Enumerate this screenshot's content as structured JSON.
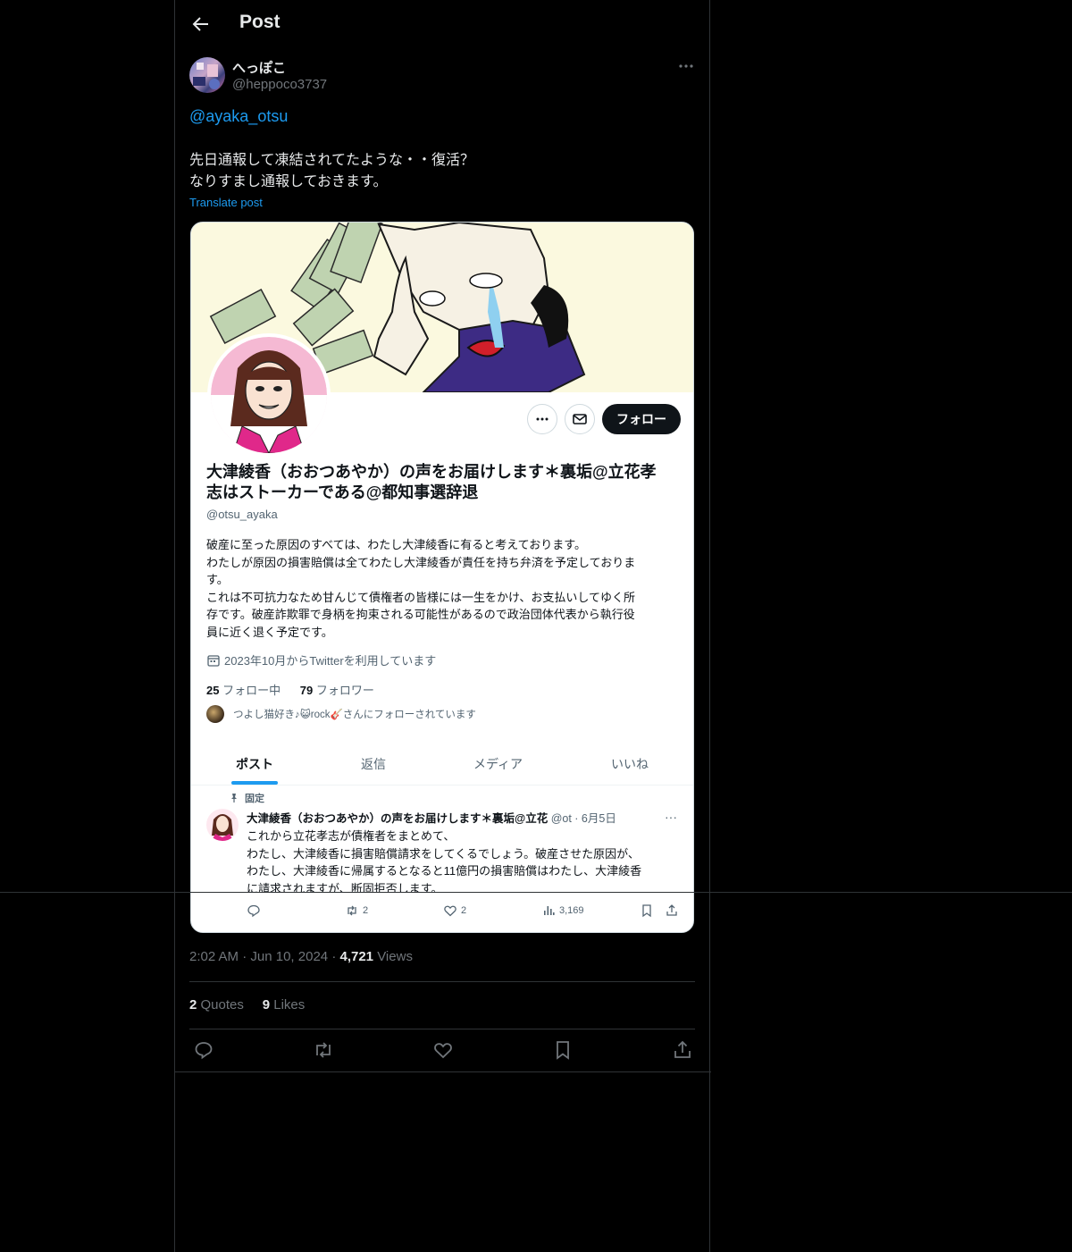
{
  "header": {
    "title": "Post"
  },
  "post": {
    "author_name": "へっぽこ",
    "author_handle": "@heppoco3737",
    "mention": "@ayaka_otsu",
    "text_line1": "先日通報して凍結されてたような・・復活？",
    "text_line2": "なりすまし通報しておきます。",
    "translate": "Translate post",
    "time": "2:02 AM",
    "date": "Jun 10, 2024",
    "views_count": "4,721",
    "views_label": "Views",
    "quotes_count": "2",
    "quotes_label": "Quotes",
    "likes_count": "9",
    "likes_label": "Likes"
  },
  "embedded_profile": {
    "follow_button": "フォロー",
    "name_line1": "大津綾香（おおつあやか）の声をお届けします＊裏垢@立花孝",
    "name_line2": "志はストーカーである@都知事選辞退",
    "handle": "@otsu_ayaka",
    "bio_line1": "破産に至った原因のすべては、わたし大津綾香に有ると考えております。",
    "bio_line2": "わたしが原因の損害賠償は全てわたし大津綾香が責任を持ち弁済を予定しておりま",
    "bio_line3": "す。",
    "bio_line4": "これは不可抗力なため甘んじて債権者の皆様には一生をかけ、お支払いしてゆく所",
    "bio_line5": "存です。破産詐欺罪で身柄を拘束される可能性があるので政治団体代表から執行役",
    "bio_line6": "員に近く退く予定です。",
    "joined": "2023年10月からTwitterを利用しています",
    "following_count": "25",
    "following_label": "フォロー中",
    "followers_count": "79",
    "followers_label": "フォロワー",
    "followed_by": "つよし猫好き♪😺rock🎸さんにフォローされています",
    "tabs": [
      "ポスト",
      "返信",
      "メディア",
      "いいね"
    ],
    "pinned_label": "固定",
    "pinned_name": "大津綾香（おおつあやか）の声をお届けします＊裏垢@立花",
    "pinned_meta": "@ot · 6月5日",
    "pinned_line1": "これから立花孝志が債権者をまとめて、",
    "pinned_line2": "わたし、大津綾香に損害賠償請求をしてくるでしょう。破産させた原因が、",
    "pinned_line3": "わたし、大津綾香に帰属するとなると11億円の損害賠償はわたし、大津綾香",
    "pinned_line4": "に請求されますが、断固拒否します。",
    "pinned_retweets": "2",
    "pinned_likes": "2",
    "pinned_views": "3,169"
  },
  "colors": {
    "accent": "#1d9bf0",
    "background": "#000000",
    "muted": "#71767b"
  }
}
